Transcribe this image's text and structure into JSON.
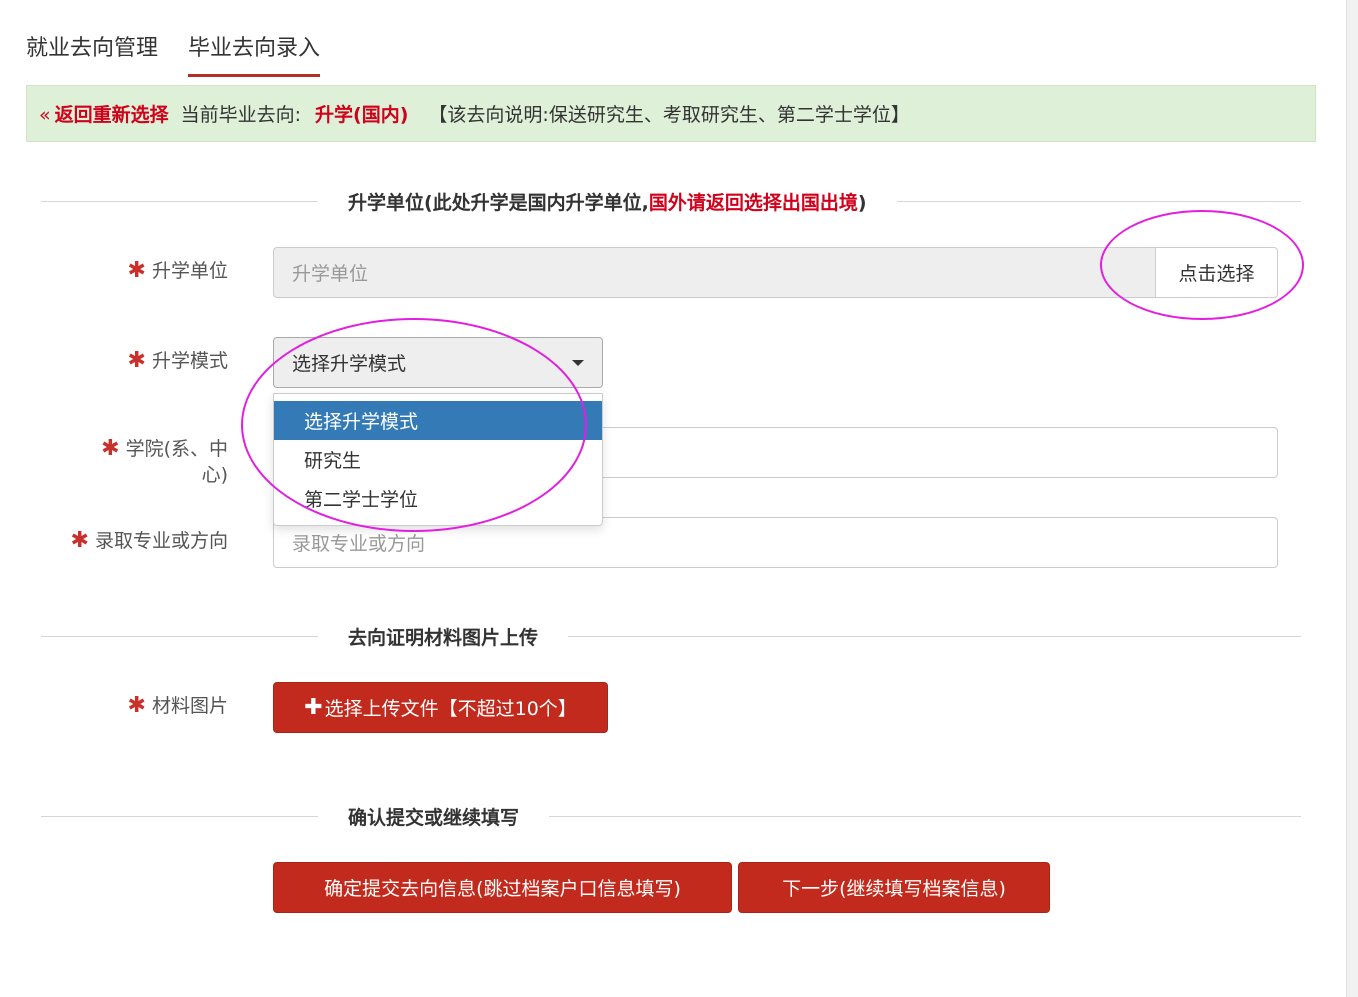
{
  "tabs": [
    {
      "label": "就业去向管理"
    },
    {
      "label": "毕业去向录入"
    }
  ],
  "alert": {
    "back_arrow": "«",
    "back_label": "返回重新选择",
    "current_prefix": "当前毕业去向:",
    "current_value": "升学(国内)",
    "description": "【该去向说明:保送研究生、考取研究生、第二学士学位】"
  },
  "section_school": {
    "title_main": "升学单位(此处升学是国内升学单位,",
    "title_red": "国外请返回选择出国出境",
    "title_end": ")"
  },
  "fields": {
    "school": {
      "label": "升学单位",
      "placeholder": "升学单位",
      "button": "点击选择"
    },
    "mode": {
      "label": "升学模式",
      "selected": "选择升学模式",
      "options": [
        "选择升学模式",
        "研究生",
        "第二学士学位"
      ]
    },
    "college": {
      "label_line1": "学院(系、中",
      "label_line2": "心)"
    },
    "major": {
      "label": "录取专业或方向",
      "placeholder": "录取专业或方向"
    }
  },
  "section_upload": {
    "title": "去向证明材料图片上传"
  },
  "upload": {
    "label": "材料图片",
    "plus": "✚",
    "button": "选择上传文件【不超过10个】"
  },
  "section_submit": {
    "title": "确认提交或继续填写"
  },
  "actions": {
    "confirm": "确定提交去向信息(跳过档案户口信息填写)",
    "next": "下一步(继续填写档案信息)"
  },
  "colors": {
    "accent_red": "#c12a1c",
    "alert_bg": "#dff0d8",
    "option_selected": "#337ab7",
    "annotation": "#e21ee0"
  }
}
